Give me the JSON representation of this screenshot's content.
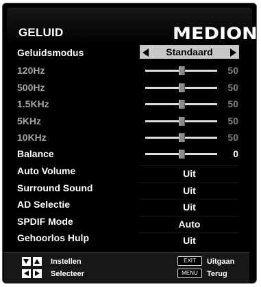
{
  "header": {
    "title": "GELUID",
    "logo": "MEDION"
  },
  "mode": {
    "label": "Geluidsmodus",
    "value": "Standaard"
  },
  "equalizer": [
    {
      "label": "120Hz",
      "value": "50",
      "level": 0.5
    },
    {
      "label": "500Hz",
      "value": "50",
      "level": 0.5
    },
    {
      "label": "1.5KHz",
      "value": "50",
      "level": 0.5
    },
    {
      "label": "5KHz",
      "value": "50",
      "level": 0.5
    },
    {
      "label": "10KHz",
      "value": "50",
      "level": 0.5
    }
  ],
  "balance": {
    "label": "Balance",
    "value": "0",
    "level": 0.5
  },
  "options": [
    {
      "label": "Auto Volume",
      "value": "Uit"
    },
    {
      "label": "Surround Sound",
      "value": "Uit"
    },
    {
      "label": "AD Selectie",
      "value": "Uit"
    },
    {
      "label": "SPDIF Mode",
      "value": "Auto"
    },
    {
      "label": "Gehoorlos Hulp",
      "value": "Uit"
    }
  ],
  "footer": {
    "set_label": "Instellen",
    "select_label": "Selecteer",
    "exit_key": "EXIT",
    "exit_label": "Uitgaan",
    "menu_key": "MENU",
    "menu_label": "Terug"
  },
  "icons": [
    "arrow-down-icon",
    "arrow-up-icon",
    "arrow-left-icon",
    "arrow-right-icon"
  ],
  "colors": {
    "background": "#000000",
    "dim_text": "#a6a6a6",
    "selected_row": "#c8c8c8"
  }
}
